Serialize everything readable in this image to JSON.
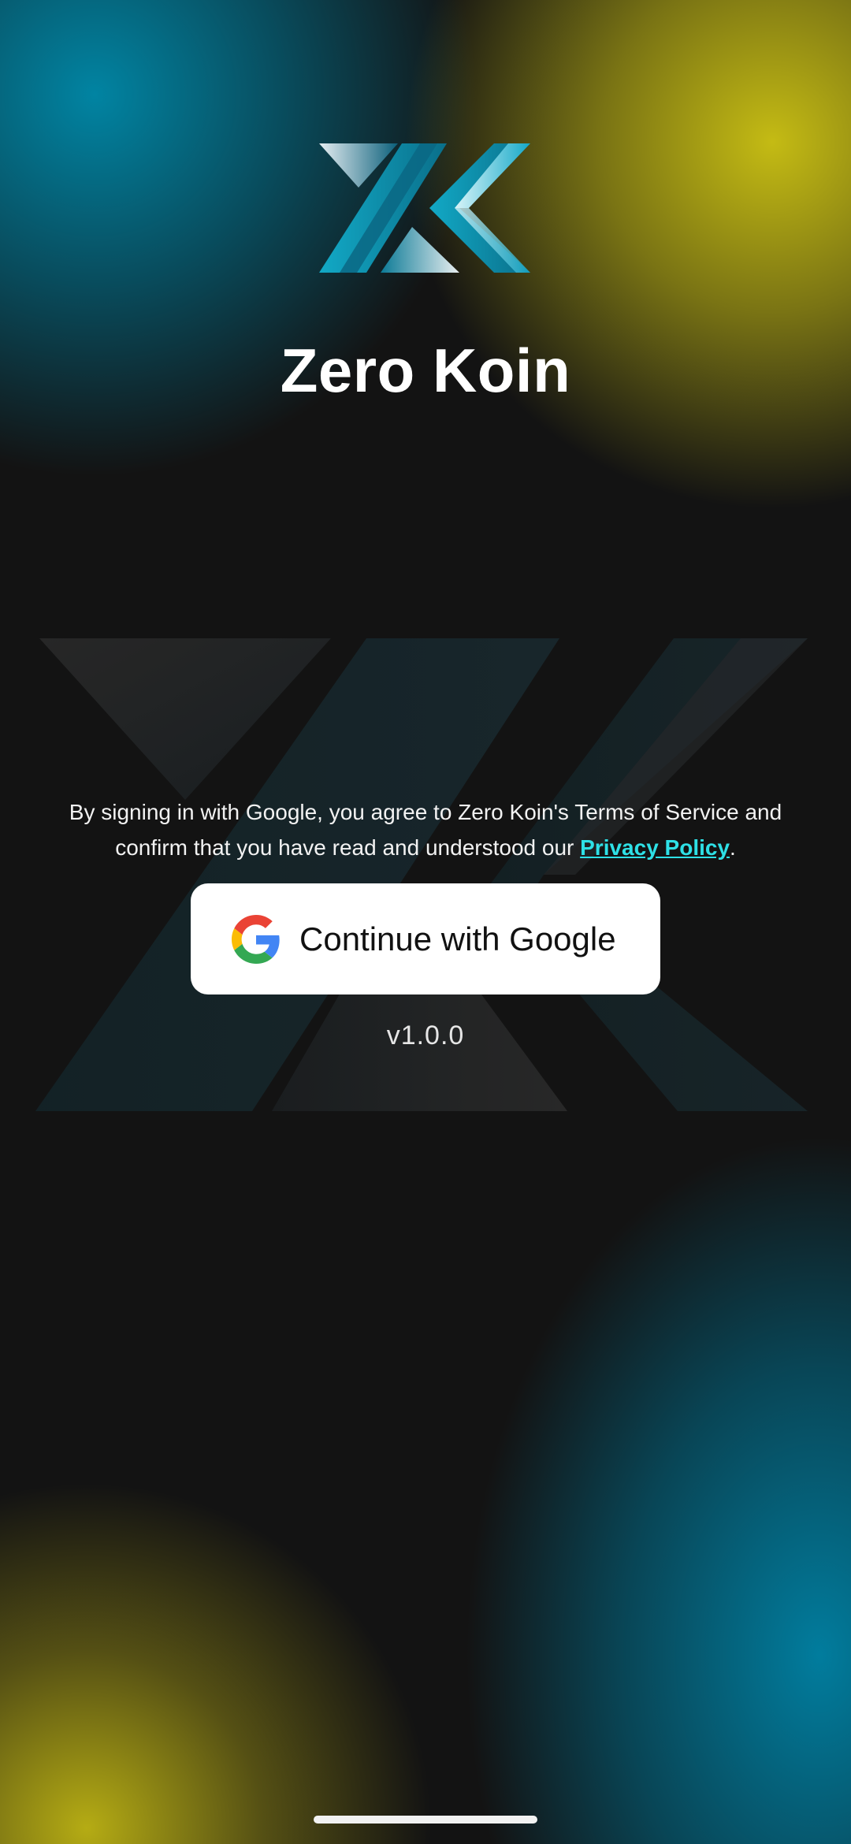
{
  "app": {
    "name": "Zero Koin"
  },
  "consent": {
    "prefix": "By signing in with Google, you agree to Zero Koin's Terms of Service and confirm that you have read and understood our ",
    "link_label": "Privacy Policy",
    "suffix": "."
  },
  "google_button": {
    "label": "Continue with Google",
    "icon": "google-g-icon"
  },
  "version": "v1.0.0",
  "colors": {
    "accent_link": "#2ee0e6",
    "teal": "#0a8aa8",
    "yellow": "#c8be18",
    "background": "#131313"
  },
  "icons": {
    "logo": "zero-koin-logo",
    "watermark": "zero-koin-watermark"
  }
}
